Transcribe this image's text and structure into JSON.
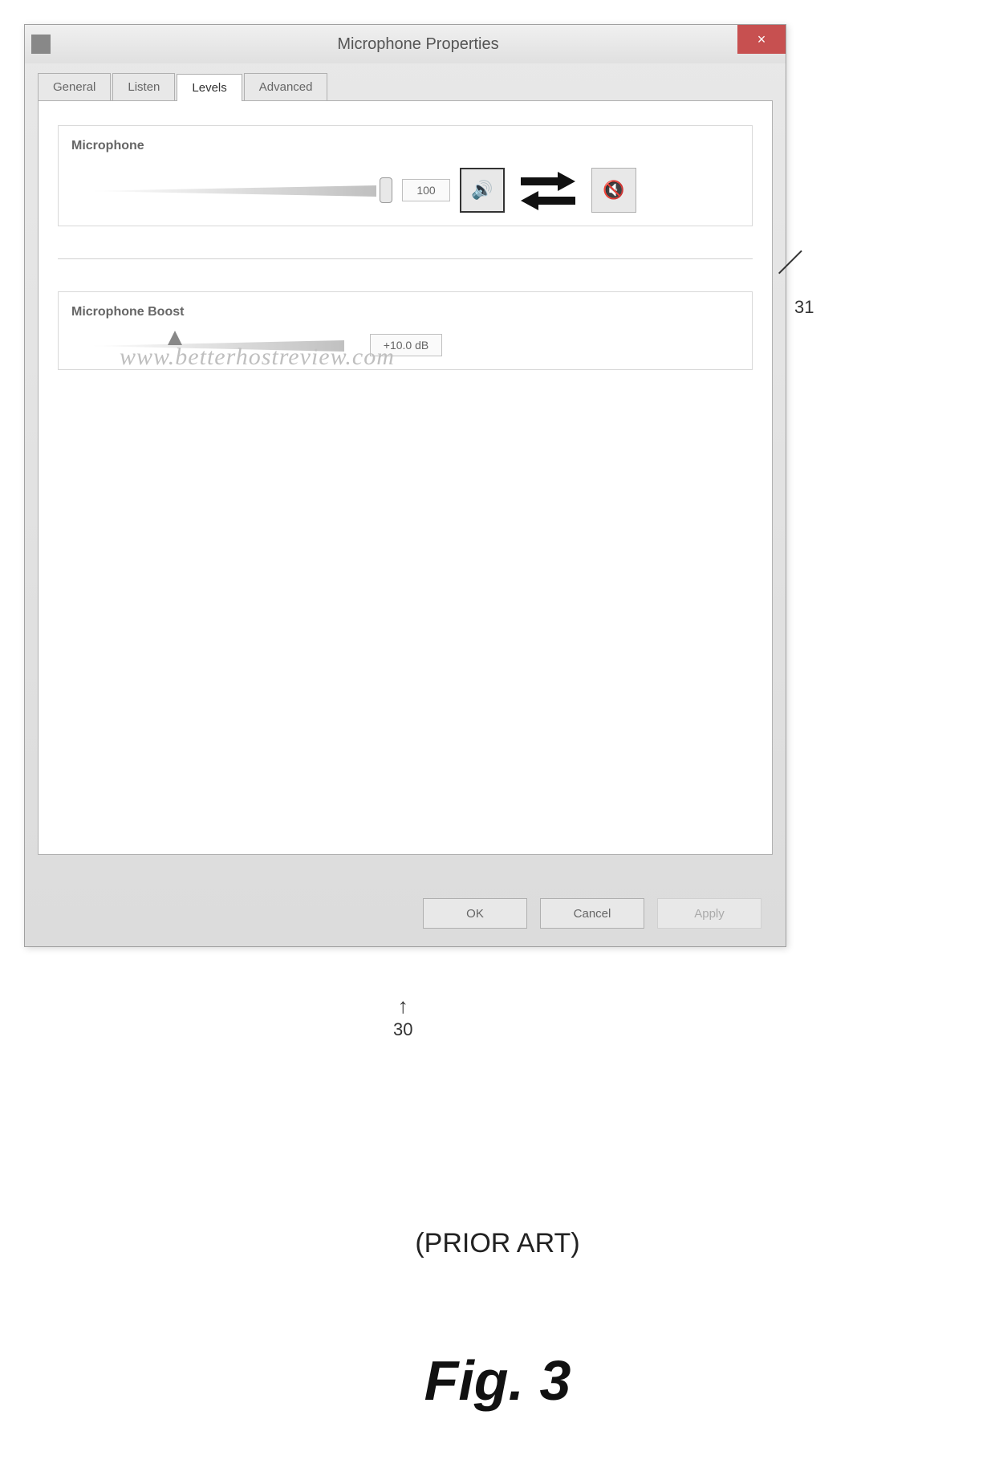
{
  "window": {
    "title": "Microphone Properties",
    "close": "×"
  },
  "tabs": [
    {
      "label": "General"
    },
    {
      "label": "Listen"
    },
    {
      "label": "Levels"
    },
    {
      "label": "Advanced"
    }
  ],
  "microphone": {
    "label": "Microphone",
    "value": "100"
  },
  "boost": {
    "label": "Microphone Boost",
    "value": "+10.0 dB"
  },
  "watermark": "www.betterhostreview.com",
  "buttons": {
    "ok": "OK",
    "cancel": "Cancel",
    "apply": "Apply"
  },
  "callouts": {
    "ref31": "31",
    "ref30": "30"
  },
  "figure": {
    "prior_art": "(PRIOR ART)",
    "label": "Fig. 3"
  }
}
